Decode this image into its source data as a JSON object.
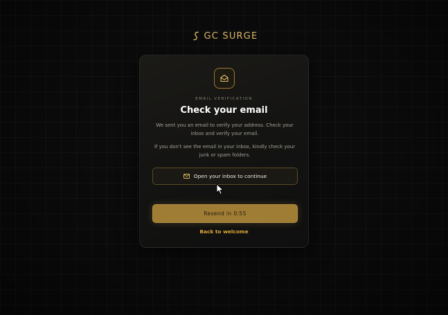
{
  "brand": {
    "name": "GC SURGE",
    "logo_icon": "s-curve-logo",
    "accent_color": "#d9b766"
  },
  "card": {
    "eyebrow": "EMAIL VERIFICATION",
    "title": "Check your email",
    "paragraph_1": "We sent you an email to verify your address. Check your inbox and verify your email.",
    "paragraph_2": "If you don't see the email in your inbox, kindly check your junk or spam folders.",
    "icon": "open-envelope-icon"
  },
  "actions": {
    "open_inbox_label": "Open your inbox to continue",
    "open_inbox_icon": "mail-icon",
    "resend_label": "Resend in 0:55",
    "resend_color": "#a07d35",
    "back_label": "Back to welcome",
    "back_color": "#e0a93a"
  }
}
